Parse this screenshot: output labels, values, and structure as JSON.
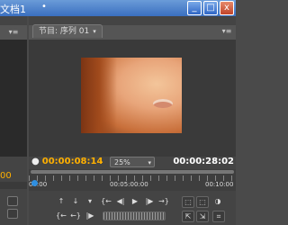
{
  "window": {
    "title": "文档1",
    "close_symbol": "x",
    "maximize_symbol": "□",
    "minimize_symbol": "_"
  },
  "left_panel": {
    "menu_symbol": "▾≡",
    "timecode": "00"
  },
  "program_monitor": {
    "tab_label": "节目: 序列 01",
    "tab_caret": "▾",
    "menu_symbol": "▾≡",
    "current_timecode": "00:00:08:14",
    "zoom": "25%",
    "zoom_caret": "▾",
    "duration_timecode": "00:00:28:02",
    "ruler_labels": [
      "00:00",
      "00:05:00:00",
      "00:10:00"
    ],
    "controls": {
      "row1": [
        "↑",
        "↓",
        "▾",
        "{←",
        "◀|",
        "▶",
        "|▶",
        "→}",
        "⬚",
        "⬚",
        "◑"
      ],
      "row2": [
        "{←",
        "←}",
        "|▶"
      ],
      "row2_right": [
        "⇱",
        "⇲",
        "⌗"
      ]
    }
  },
  "colors": {
    "timecode_current": "#ffb000",
    "playhead": "#2f8fe0",
    "titlebar": "#3a6fc0"
  }
}
